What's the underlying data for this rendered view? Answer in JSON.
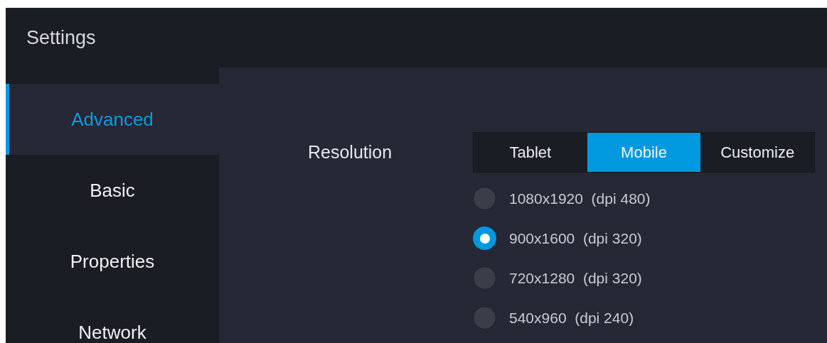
{
  "window": {
    "title": "Settings"
  },
  "sidebar": {
    "items": [
      {
        "label": "Advanced",
        "selected": true
      },
      {
        "label": "Basic",
        "selected": false
      },
      {
        "label": "Properties",
        "selected": false
      },
      {
        "label": "Network",
        "selected": false
      }
    ]
  },
  "resolution": {
    "label": "Resolution",
    "modes": [
      {
        "label": "Tablet",
        "selected": false
      },
      {
        "label": "Mobile",
        "selected": true
      },
      {
        "label": "Customize",
        "selected": false
      }
    ],
    "options": [
      {
        "label": "1080x1920  (dpi 480)",
        "selected": false
      },
      {
        "label": "900x1600  (dpi 320)",
        "selected": true
      },
      {
        "label": "720x1280  (dpi 320)",
        "selected": false
      },
      {
        "label": "540x960  (dpi 240)",
        "selected": false
      }
    ]
  }
}
